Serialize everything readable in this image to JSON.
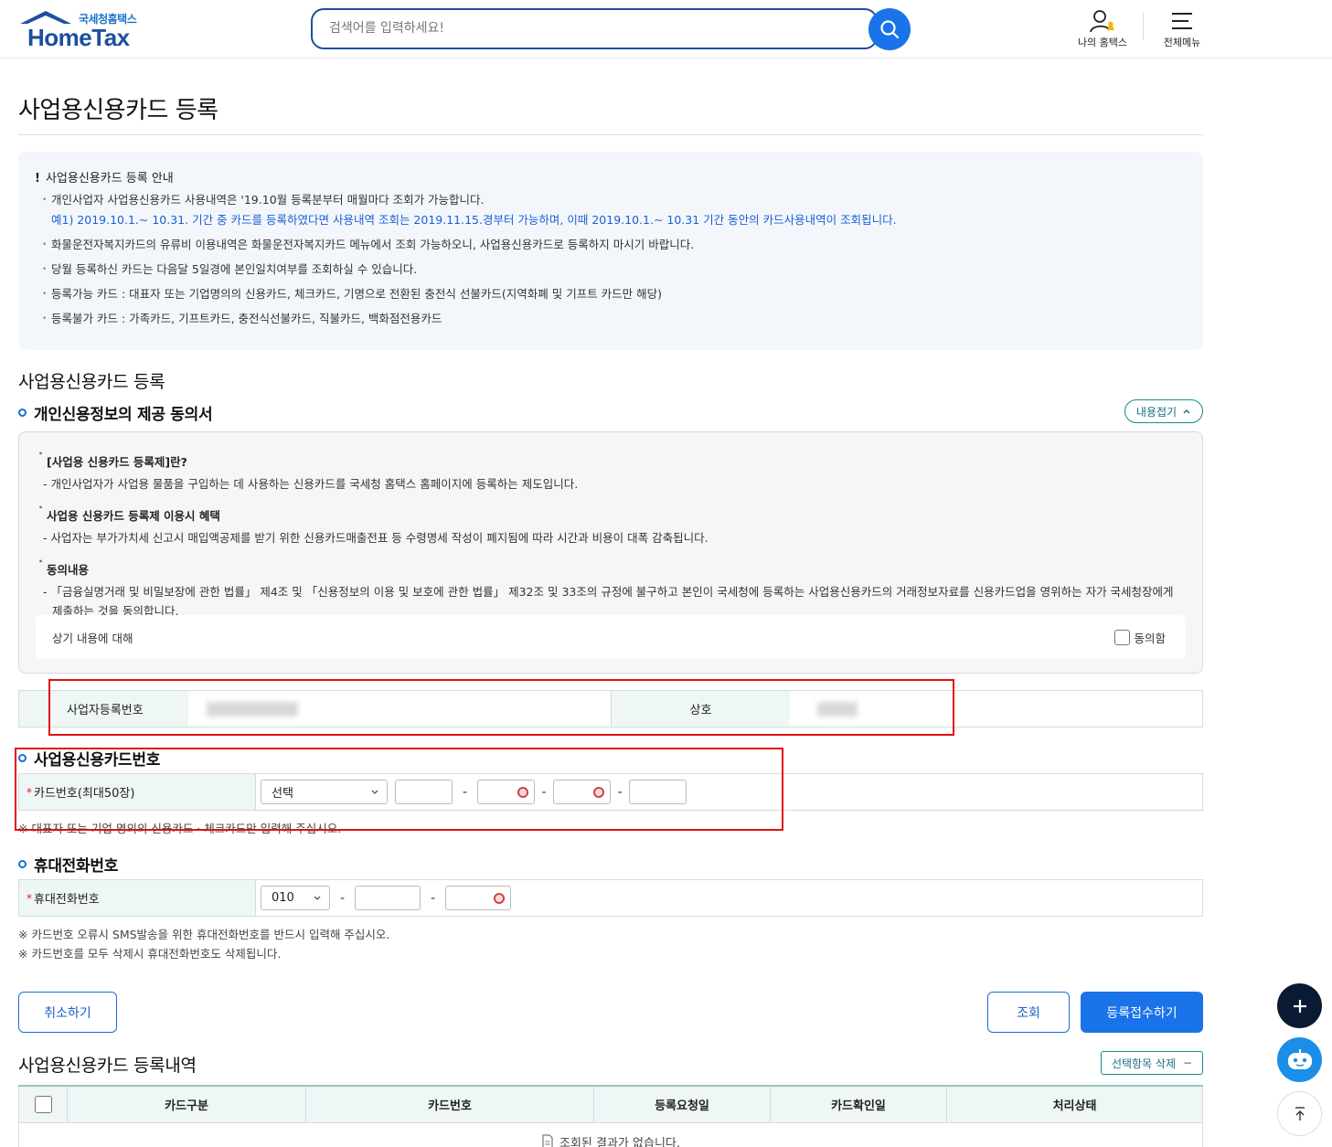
{
  "header": {
    "logo_small": "국세청홈택스",
    "logo_big": "HomeTax",
    "search_placeholder": "검색어를 입력하세요!",
    "my_hometax": "나의 홈택스",
    "all_menu": "전체메뉴"
  },
  "page_title": "사업용신용카드 등록",
  "notice": {
    "heading_mark": "!",
    "heading": "사업용신용카드 등록 안내",
    "item1": "개인사업자 사업용신용카드 사용내역은 '19.10월 등록분부터 매월마다 조회가 가능합니다.",
    "example": "예1) 2019.10.1.~ 10.31. 기간 중 카드를 등록하였다면 사용내역 조회는 2019.11.15.경부터 가능하며, 이때 2019.10.1.~ 10.31 기간 동안의 카드사용내역이 조회됩니다.",
    "item2": "화물운전자복지카드의 유류비 이용내역은 화물운전자복지카드 메뉴에서 조회 가능하오니, 사업용신용카드로 등록하지 마시기 바랍니다.",
    "item3": "당월 등록하신 카드는 다음달 5일경에 본인일치여부를 조회하실 수 있습니다.",
    "item4": "등록가능 카드 : 대표자 또는 기업명의의 신용카드, 체크카드, 기명으로 전환된 충전식 선불카드(지역화폐 및 기프트 카드만 해당)",
    "item5": "등록불가 카드 : 가족카드, 기프트카드, 충전식선불카드, 직불카드, 백화점전용카드"
  },
  "section_register": "사업용신용카드 등록",
  "consent": {
    "title": "개인신용정보의 제공 동의서",
    "collapse_label": "내용접기",
    "h1": "[사업용 신용카드 등록제]란?",
    "d1": "- 개인사업자가 사업용 물품을 구입하는 데 사용하는 신용카드를 국세청 홈택스 홈페이지에 등록하는 제도입니다.",
    "h2": "사업용 신용카드 등록제 이용시 혜택",
    "d2": "- 사업자는 부가가치세 신고시 매입액공제를 받기 위한 신용카드매출전표 등 수령명세 작성이 폐지됨에 따라 시간과 비용이 대폭 감축됩니다.",
    "h3": "동의내용",
    "d3a": "- 「금융실명거래 및 비밀보장에 관한 법률」 제4조 및 「신용정보의 이용 및 보호에 관한 법률」 제32조 및 33조의 규정에 불구하고 본인이 국세청에 등록하는 사업용신용카드의   거래정보자료를 신용카드업을 영위하는 자가 국세청장에게",
    "d3b": "제출하는 것을 동의합니다.",
    "agree_prompt": "상기 내용에 대해",
    "agree_label": "동의함"
  },
  "business": {
    "reg_no_label": "사업자등록번호",
    "name_label": "상호"
  },
  "card_section": {
    "title": "사업용신용카드번호",
    "label": "카드번호(최대50장)",
    "required_mark": "*",
    "select_value": "선택",
    "dash": "-",
    "note": "※ 대표자 또는 기업 명의의 신용카드 · 체크카드만 입력해 주십시오."
  },
  "phone_section": {
    "title": "휴대전화번호",
    "label": "휴대전화번호",
    "required_mark": "*",
    "prefix_value": "010",
    "dash": "-",
    "note1": "※ 카드번호 오류시 SMS발송을 위한 휴대전화번호를 반드시 입력해 주십시오.",
    "note2": "※ 카드번호를 모두 삭제시 휴대전화번호도 삭제됩니다."
  },
  "buttons": {
    "cancel": "취소하기",
    "query": "조회",
    "submit": "등록접수하기"
  },
  "history": {
    "title": "사업용신용카드 등록내역",
    "delete_label": "선택항목 삭제",
    "delete_mark": "−",
    "columns": [
      "카드구분",
      "카드번호",
      "등록요청일",
      "카드확인일",
      "처리상태"
    ],
    "empty": "조회된 결과가 없습니다."
  },
  "colors": {
    "brand": "#1c4fa0",
    "accent": "#1a73e8",
    "highlight": "#e01010",
    "label_bg": "#eef6f6"
  }
}
